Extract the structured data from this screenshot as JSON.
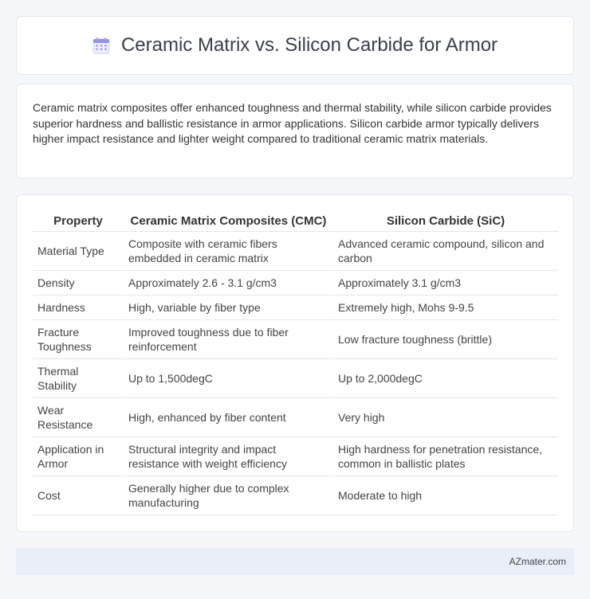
{
  "header": {
    "title": "Ceramic Matrix vs. Silicon Carbide for Armor",
    "icon": "calendar-icon"
  },
  "summary": "Ceramic matrix composites offer enhanced toughness and thermal stability, while silicon carbide provides superior hardness and ballistic resistance in armor applications. Silicon carbide armor typically delivers higher impact resistance and lighter weight compared to traditional ceramic matrix materials.",
  "table": {
    "headers": [
      "Property",
      "Ceramic Matrix Composites (CMC)",
      "Silicon Carbide (SiC)"
    ],
    "rows": [
      [
        "Material Type",
        "Composite with ceramic fibers embedded in ceramic matrix",
        "Advanced ceramic compound, silicon and carbon"
      ],
      [
        "Density",
        "Approximately 2.6 - 3.1 g/cm3",
        "Approximately 3.1 g/cm3"
      ],
      [
        "Hardness",
        "High, variable by fiber type",
        "Extremely high, Mohs 9-9.5"
      ],
      [
        "Fracture Toughness",
        "Improved toughness due to fiber reinforcement",
        "Low fracture toughness (brittle)"
      ],
      [
        "Thermal Stability",
        "Up to 1,500degC",
        "Up to 2,000degC"
      ],
      [
        "Wear Resistance",
        "High, enhanced by fiber content",
        "Very high"
      ],
      [
        "Application in Armor",
        "Structural integrity and impact resistance with weight efficiency",
        "High hardness for penetration resistance, common in ballistic plates"
      ],
      [
        "Cost",
        "Generally higher due to complex manufacturing",
        "Moderate to high"
      ]
    ]
  },
  "footer": {
    "brand": "AZmater.com"
  }
}
